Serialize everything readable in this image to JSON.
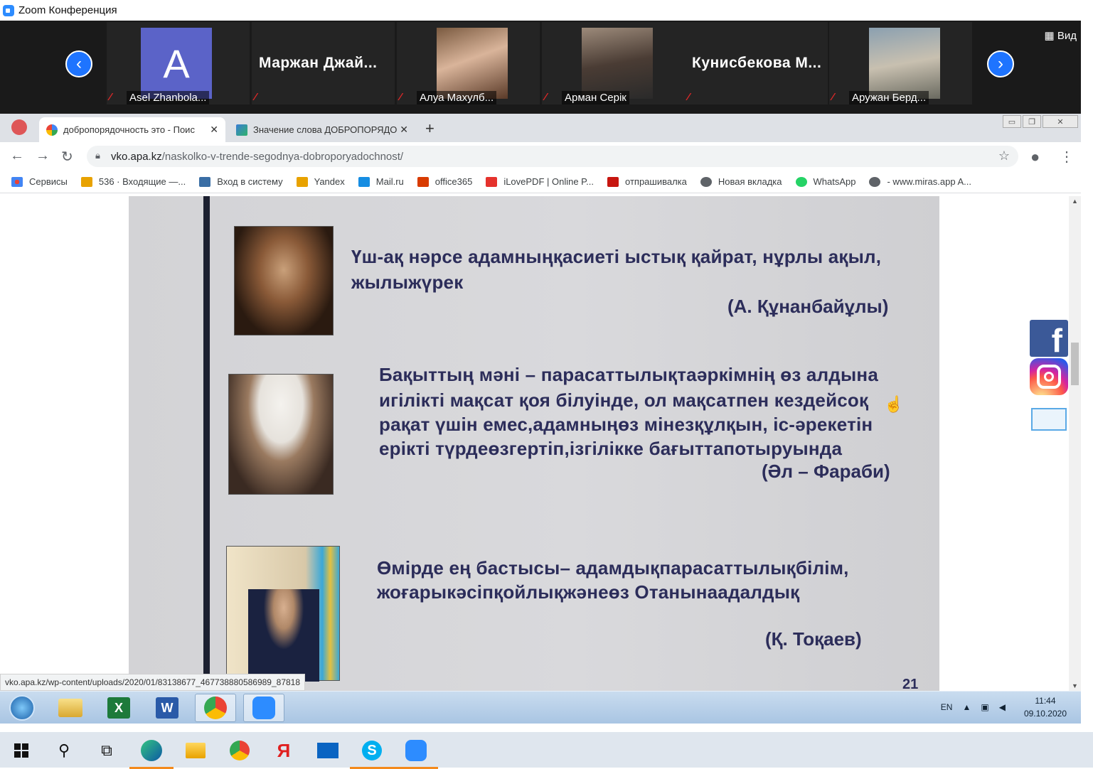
{
  "zoom": {
    "window_title": "Zoom Конференция",
    "view_label": "Вид",
    "participants": [
      {
        "name": "Asel Zhanbola...",
        "avatar_letter": "A",
        "kind": "avatar"
      },
      {
        "name": "Маржан Джай...",
        "kind": "text"
      },
      {
        "name": "Алуа Махулб...",
        "kind": "photo"
      },
      {
        "name": "Арман Серік",
        "kind": "photo"
      },
      {
        "name": "Кунисбекова М...",
        "kind": "text"
      },
      {
        "name": "Аружан Берд...",
        "kind": "photo"
      }
    ]
  },
  "browser": {
    "tabs": [
      {
        "title": "добропорядочность это - Поис",
        "active": true
      },
      {
        "title": "Значение слова ДОБРОПОРЯДО",
        "active": false
      }
    ],
    "new_tab_label": "+",
    "url_host": "vko.apa.kz",
    "url_path": "/naskolko-v-trende-segodnya-dobroporyadochnost/",
    "bookmarks": [
      {
        "label": "Сервисы",
        "color": "#ea4335"
      },
      {
        "label": "536 · Входящие —...",
        "color": "#e8a200"
      },
      {
        "label": "Вход в систему",
        "color": "#3a6ea5"
      },
      {
        "label": "Yandex",
        "color": "#e8a200"
      },
      {
        "label": "Mail.ru",
        "color": "#168de2"
      },
      {
        "label": "office365",
        "color": "#d83b01"
      },
      {
        "label": "iLovePDF | Online P...",
        "color": "#e5322d"
      },
      {
        "label": "отпрашивалка",
        "color": "#c71610"
      },
      {
        "label": "Новая вкладка",
        "color": "#5f6368"
      },
      {
        "label": "WhatsApp",
        "color": "#25d366"
      },
      {
        "label": "- www.miras.app A...",
        "color": "#5f6368"
      }
    ],
    "status_url": "vko.apa.kz/wp-content/uploads/2020/01/83138677_467738880586989_87818"
  },
  "book_page": {
    "quotes": [
      {
        "text_line1": "Үш-ақ нәрсе адамныңқасиеті  ыстық қайрат, нұрлы ақыл,",
        "text_line2": "жылыжүрек",
        "author": "(А. Құнанбайұлы)"
      },
      {
        "text_line1": "Бақыттың мәні – парасаттылықтаәркімнің өз алдына",
        "text_line2": "игілікті  мақсат қоя білуінде, ол мақсатпен кездейсоқ",
        "text_line3": "рақат үшін  емес,адамныңөз мінезқұлқын, іс-әрекетін",
        "text_line4": "ерікті түрдеөзгертіп,ізгілікке бағыттапотыруында",
        "author": "(Әл – Фараби)"
      },
      {
        "text_line1": "Өмірде ең бастысы– адамдықпарасаттылықбілім,",
        "text_line2": "жоғарыкәсіпқойлықжәнеөз Отанынаадалдық",
        "author": "(Қ. Тоқаев)"
      }
    ],
    "page_number": "21"
  },
  "taskbar_inner": {
    "lang": "EN",
    "time": "11:44",
    "date": "09.10.2020"
  }
}
